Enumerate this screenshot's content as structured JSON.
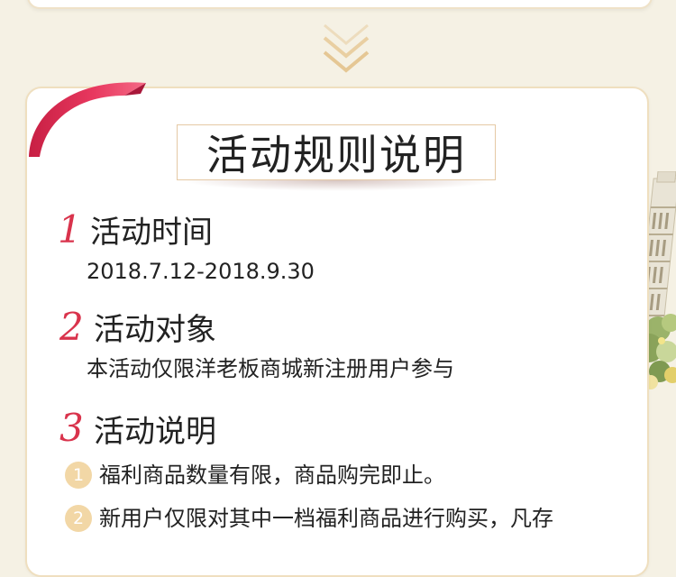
{
  "colors": {
    "accent_red": "#d9334c",
    "chevron_gold": "#e9cfa2",
    "card_border": "#efdfbf",
    "bullet_fill": "#f2d7a6",
    "page_background": "#f5f1e4"
  },
  "decorations": {
    "scroll_hint_icon": "double-chevron-down",
    "corner_ribbon_icon": "red-ribbon",
    "side_illustration_icon": "leaning-tower"
  },
  "rules": {
    "title": "活动规则说明",
    "sections": [
      {
        "number": "1",
        "heading": "活动时间",
        "body": "2018.7.12-2018.9.30"
      },
      {
        "number": "2",
        "heading": "活动对象",
        "body": "本活动仅限洋老板商城新注册用户参与"
      },
      {
        "number": "3",
        "heading": "活动说明",
        "items": [
          {
            "marker": "1",
            "text": "福利商品数量有限，商品购完即止。"
          },
          {
            "marker": "2",
            "text": "新用户仅限对其中一档福利商品进行购买，凡存"
          }
        ]
      }
    ]
  }
}
